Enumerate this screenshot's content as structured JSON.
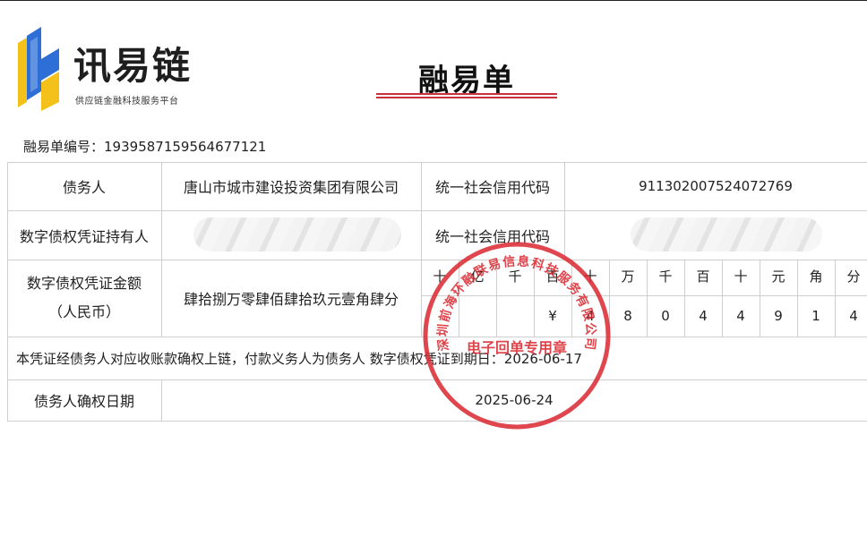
{
  "brand": {
    "name": "讯易链",
    "tagline": "供应链金融科技服务平台",
    "colors": {
      "blue": "#2d6fd6",
      "yellow": "#f3c11a",
      "dark": "#1e1e1e"
    }
  },
  "document": {
    "title": "融易单",
    "number_label": "融易单编号：",
    "number": "1939587159564677121"
  },
  "table": {
    "debtor_label": "债务人",
    "debtor_value": "唐山市城市建设投资集团有限公司",
    "credit_code_label": "统一社会信用代码",
    "debtor_credit_code": "911302007524072769",
    "holder_label": "数字债权凭证持有人",
    "holder_credit_code_label": "统一社会信用代码",
    "amount_label_line1": "数字债权凭证金额",
    "amount_label_line2": "（人民币）",
    "amount_in_words": "肆拾捌万零肆佰肆拾玖元壹角肆分",
    "amount_units": [
      "十",
      "亿",
      "千",
      "百",
      "十",
      "万",
      "千",
      "百",
      "十",
      "元",
      "角",
      "分"
    ],
    "amount_digits": [
      "",
      "",
      "",
      "¥",
      "4",
      "8",
      "0",
      "4",
      "4",
      "9",
      "1",
      "4"
    ],
    "note": "本凭证经债务人对应收账款确权上链，付款义务人为债务人  数字债权凭证到期日：2026-06-17",
    "confirm_date_label": "债务人确权日期",
    "confirm_date": "2025-06-24"
  },
  "stamp": {
    "company": "深圳前海环融联易信息科技服务有限公司",
    "purpose": "电子回单专用章",
    "color": "#d9262e"
  }
}
